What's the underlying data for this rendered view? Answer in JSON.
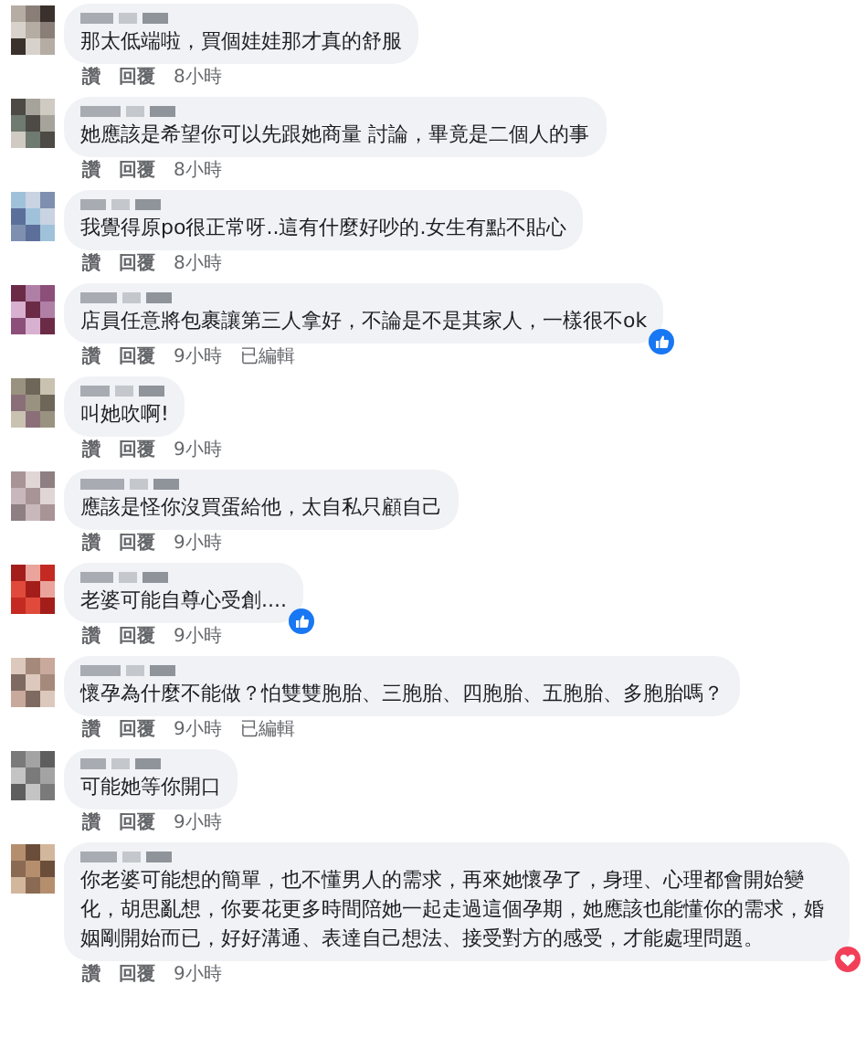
{
  "comments": [
    {
      "text": "那太低端啦，買個娃娃那才真的舒服",
      "actions": [
        "讚",
        "回覆",
        "8小時"
      ]
    },
    {
      "text": "她應該是希望你可以先跟她商量 討論，畢竟是二個人的事",
      "actions": [
        "讚",
        "回覆",
        "8小時"
      ]
    },
    {
      "text": "我覺得原po很正常呀..這有什麼好吵的.女生有點不貼心",
      "actions": [
        "讚",
        "回覆",
        "8小時"
      ]
    },
    {
      "text": "店員任意將包裹讓第三人拿好，不論是不是其家人，一樣很不ok",
      "actions": [
        "讚",
        "回覆",
        "9小時",
        "已編輯"
      ],
      "reaction": {
        "kind": "like"
      }
    },
    {
      "text": "叫她吹啊!",
      "actions": [
        "讚",
        "回覆",
        "9小時"
      ]
    },
    {
      "text": "應該是怪你沒買蛋給他，太自私只顧自己",
      "actions": [
        "讚",
        "回覆",
        "9小時"
      ]
    },
    {
      "text": "老婆可能自尊心受創....",
      "actions": [
        "讚",
        "回覆",
        "9小時"
      ],
      "reaction": {
        "kind": "like"
      }
    },
    {
      "text": "懷孕為什麼不能做？怕雙雙胞胎、三胞胎、四胞胎、五胞胎、多胞胎嗎？",
      "actions": [
        "讚",
        "回覆",
        "9小時",
        "已編輯"
      ]
    },
    {
      "text": "可能她等你開口",
      "actions": [
        "讚",
        "回覆",
        "9小時"
      ]
    },
    {
      "text": "你老婆可能想的簡單，也不懂男人的需求，再來她懷孕了，身理、心理都會開始變化，胡思亂想，你要花更多時間陪她一起走過這個孕期，她應該也能懂你的需求，婚姻剛開始而已，好好溝通、表達自己想法、接受對方的感受，才能處理問題。",
      "actions": [
        "讚",
        "回覆",
        "9小時"
      ],
      "reaction": {
        "kind": "heart"
      }
    }
  ]
}
